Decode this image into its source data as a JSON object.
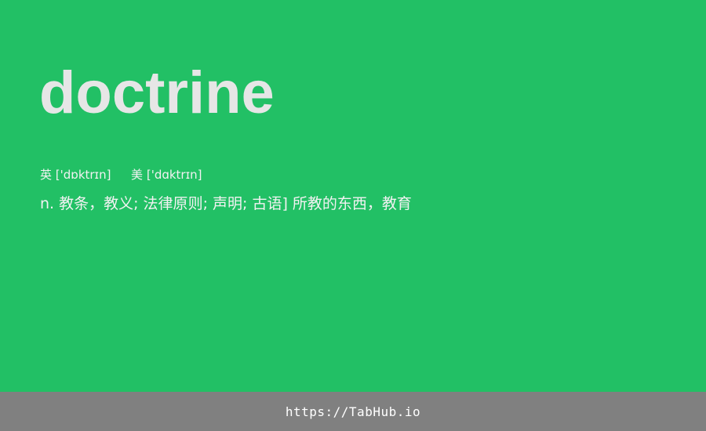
{
  "word": "doctrine",
  "phonetics": {
    "uk_label": "英",
    "uk_ipa": "['dɒktrɪn]",
    "us_label": "美",
    "us_ipa": "['dɑktrɪn]"
  },
  "definition": "n. 教条，教义; 法律原则; 声明; 古语] 所教的东西，教育",
  "footer": {
    "url": "https://TabHub.io"
  },
  "colors": {
    "background": "#22c065",
    "footer_bar": "#808080",
    "word_text": "#e6e6e6"
  }
}
